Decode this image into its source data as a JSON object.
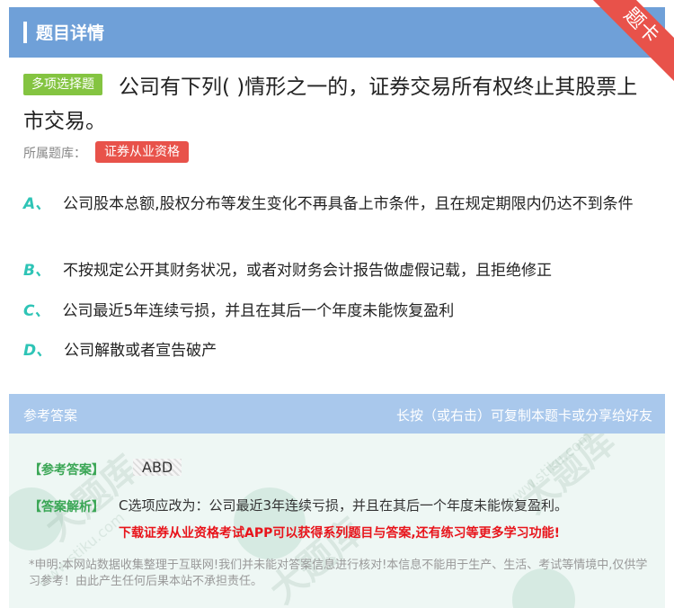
{
  "header": {
    "title": "题目详情",
    "corner_label": "题卡"
  },
  "question": {
    "type_tag": "多项选择题",
    "text": "公司有下列( )情形之一的，证券交易所有权终止其股票上市交易。",
    "bank_label": "所属题库：",
    "bank_tag": "证券从业资格"
  },
  "options": [
    {
      "letter": "A、",
      "text": "公司股本总额,股权分布等发生变化不再具备上市条件，且在规定期限内仍达不到条件"
    },
    {
      "letter": "B、",
      "text": "不按规定公开其财务状况，或者对财务会计报告做虚假记载，且拒绝修正"
    },
    {
      "letter": "C、",
      "text": "公司最近5年连续亏损，并且在其后一个年度未能恢复盈利"
    },
    {
      "letter": "D、",
      "text": "公司解散或者宣告破产"
    }
  ],
  "answer_section": {
    "header_left": "参考答案",
    "header_right": "长按（或右击）可复制本题卡或分享给好友",
    "answer_label": "【参考答案】",
    "answer_value": "ABD",
    "analysis_label": "【答案解析】",
    "analysis_text": "C选项应改为：公司最近3年连续亏损，并且在其后一个年度未能恢复盈利。",
    "promo": "下载证券从业资格考试APP可以获得系列题目与答案,还有练习等更多学习功能!",
    "disclaimer": "*申明:本网站数据收集整理于互联网!我们并未能对答案信息进行核对!本信息不能用于生产、生活、考试等情境中,仅供学习参考！由此产生任何后果本站不承担责任。"
  },
  "watermarks": {
    "text1": "大题库",
    "text2": "www.stiku.com"
  },
  "colors": {
    "header_bg": "#6fa0d8",
    "ribbon": "#e8524a",
    "tag_green": "#84c441",
    "option_letter": "#2ec4b6",
    "promo_red": "#e8141b"
  }
}
